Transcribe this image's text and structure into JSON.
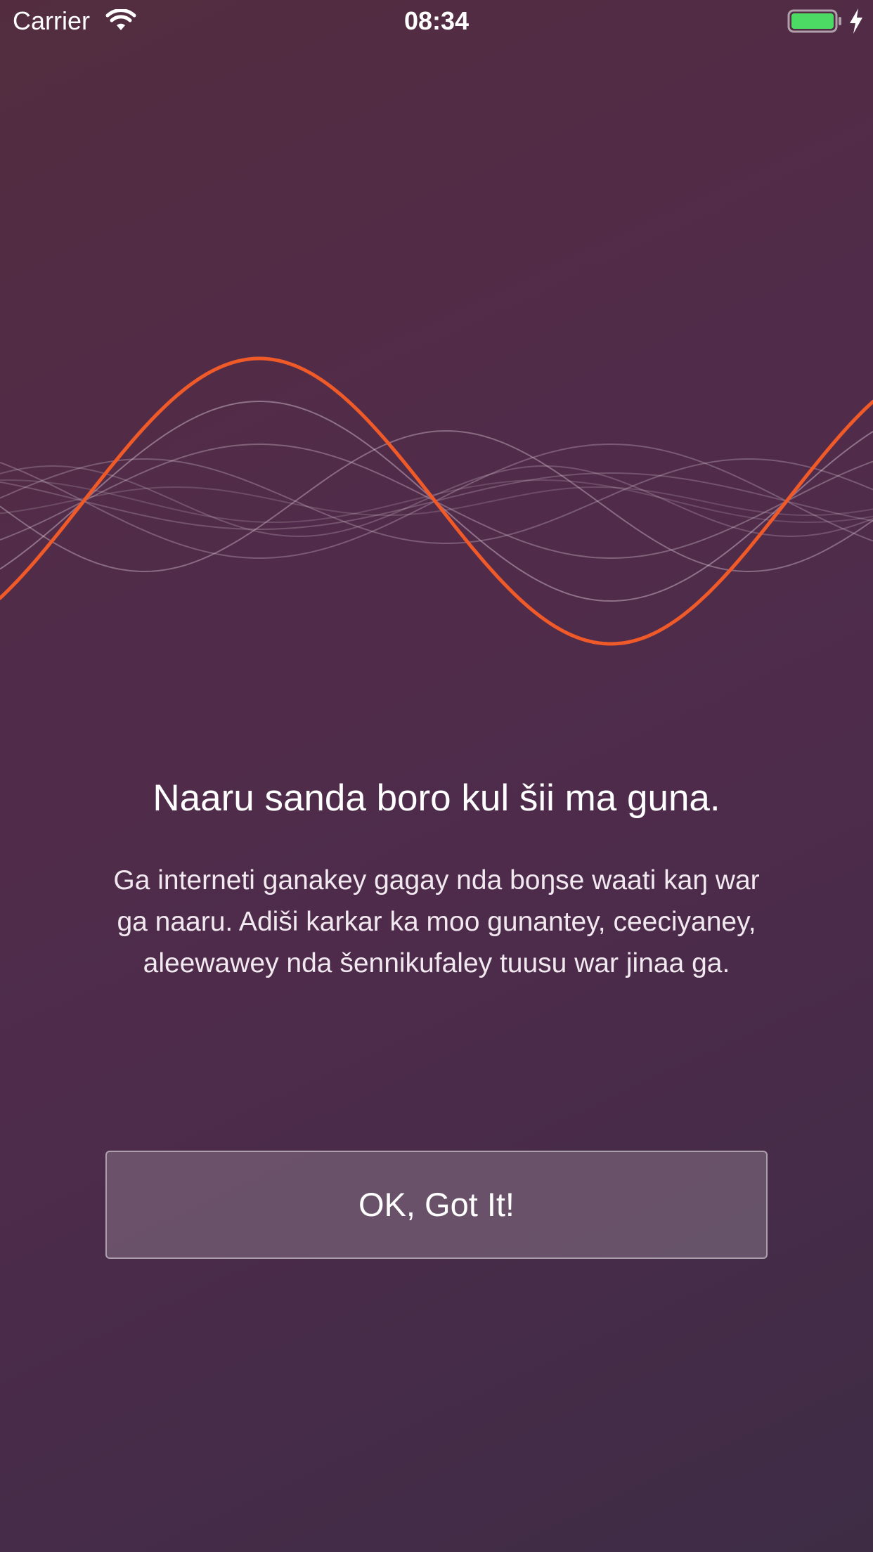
{
  "status_bar": {
    "carrier": "Carrier",
    "time": "08:34",
    "wifi_icon": "wifi-icon",
    "battery_icon": "battery-icon",
    "charging_icon": "lightning-bolt-icon",
    "battery_level": 1.0,
    "battery_color": "#4cd964"
  },
  "visual": {
    "waveform_icon": "sound-waveform",
    "accent_color": "#f05a28"
  },
  "content": {
    "title": "Naaru sanda boro kul šii ma guna.",
    "description": "Ga interneti ganakey gagay nda boŋse waati kaŋ war ga naaru. Adiši karkar ka moo gunantey, ceeciyaney, aleewawey nda šennikufaley tuusu war jinaa ga."
  },
  "actions": {
    "ok_button": "OK, Got It!"
  }
}
